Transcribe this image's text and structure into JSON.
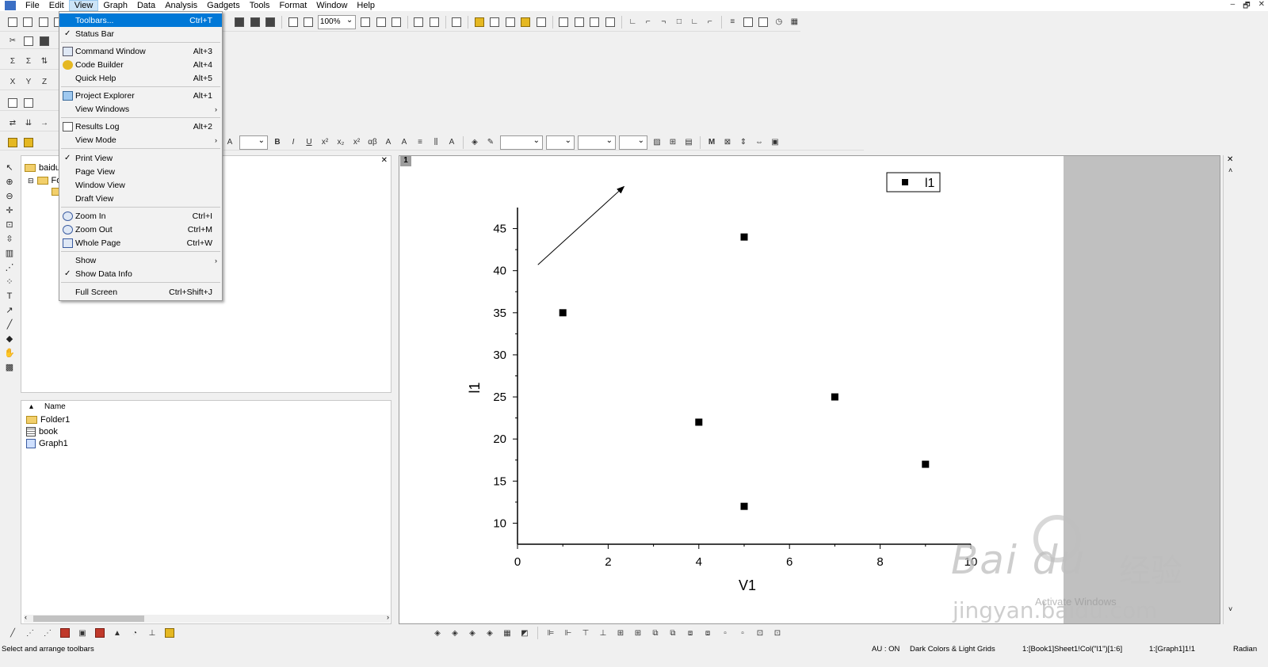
{
  "menubar": {
    "items": [
      "File",
      "Edit",
      "View",
      "Graph",
      "Data",
      "Analysis",
      "Gadgets",
      "Tools",
      "Format",
      "Window",
      "Help"
    ],
    "active": "View",
    "window_controls": [
      "–",
      "🗗",
      "✕"
    ]
  },
  "toolbar": {
    "zoom": "100%"
  },
  "view_menu": {
    "items": [
      {
        "label": "Toolbars...",
        "shortcut": "Ctrl+T"
      },
      {
        "label": "Status Bar",
        "shortcut": ""
      },
      {
        "label": "Command Window",
        "shortcut": "Alt+3"
      },
      {
        "label": "Code Builder",
        "shortcut": "Alt+4"
      },
      {
        "label": "Quick Help",
        "shortcut": "Alt+5"
      },
      {
        "label": "Project Explorer",
        "shortcut": "Alt+1"
      },
      {
        "label": "View Windows",
        "shortcut": ""
      },
      {
        "label": "Results Log",
        "shortcut": "Alt+2"
      },
      {
        "label": "View Mode",
        "shortcut": ""
      },
      {
        "label": "Print View",
        "shortcut": ""
      },
      {
        "label": "Page View",
        "shortcut": ""
      },
      {
        "label": "Window View",
        "shortcut": ""
      },
      {
        "label": "Draft View",
        "shortcut": ""
      },
      {
        "label": "Zoom In",
        "shortcut": "Ctrl+I"
      },
      {
        "label": "Zoom Out",
        "shortcut": "Ctrl+M"
      },
      {
        "label": "Whole Page",
        "shortcut": "Ctrl+W"
      },
      {
        "label": "Show",
        "shortcut": ""
      },
      {
        "label": "Show Data Info",
        "shortcut": ""
      },
      {
        "label": "Full Screen",
        "shortcut": "Ctrl+Shift+J"
      }
    ],
    "check": "✓",
    "submenu_arrow": "›"
  },
  "project_explorer": {
    "tree": [
      "baidu",
      "Fo"
    ],
    "list_header": "Name",
    "files": [
      "Folder1",
      "book",
      "Graph1"
    ]
  },
  "graph": {
    "layer_tab": "1",
    "legend_label": "l1"
  },
  "chart_data": {
    "type": "scatter",
    "x": [
      1,
      4,
      5,
      5,
      7,
      9
    ],
    "y": [
      35,
      22,
      44,
      12,
      25,
      17
    ],
    "xlabel": "V1",
    "ylabel": "l1",
    "xlim": [
      0,
      10
    ],
    "ylim": [
      7.5,
      47.5
    ],
    "xticks": [
      0,
      2,
      4,
      6,
      8,
      10
    ],
    "yticks": [
      10,
      15,
      20,
      25,
      30,
      35,
      40,
      45
    ],
    "series": [
      {
        "name": "l1",
        "marker": "square",
        "color": "#000000"
      }
    ],
    "legend": "top-right",
    "annotation": "arrow"
  },
  "statusbar": {
    "message": "Select and arrange toolbars",
    "au": "AU : ON",
    "theme": "Dark Colors & Light Grids",
    "cell_ref": "1:[Book1]Sheet1!Col(\"l1\")[1:6]",
    "graph_ref": "1:[Graph1]1!1",
    "unit": "Radian"
  },
  "watermark": {
    "brand": "Bai du",
    "cn": "经验",
    "url": "jingyan.baidu.com",
    "activate": "Activate Windows"
  }
}
